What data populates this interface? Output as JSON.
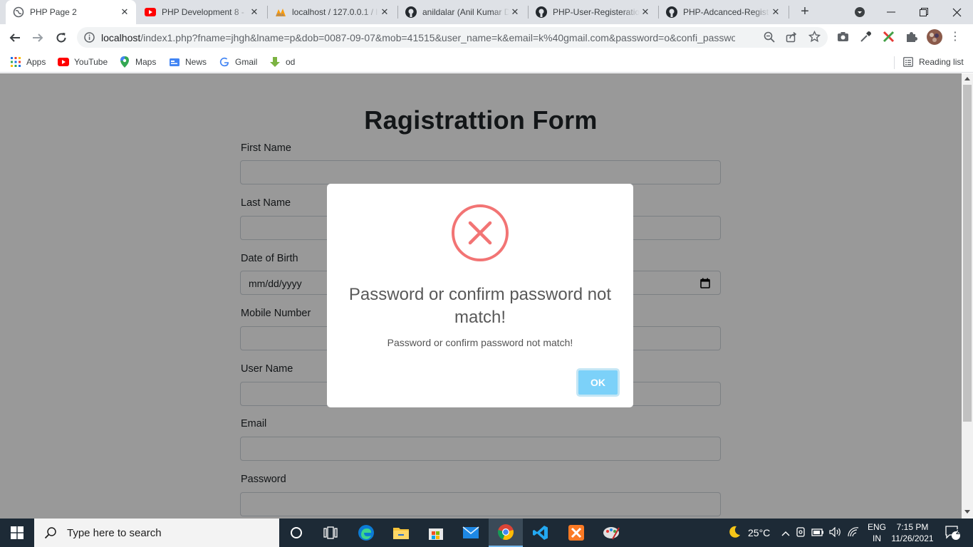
{
  "browser": {
    "tabs": [
      {
        "title": "PHP Page 2",
        "icon": "globe-icon",
        "active": true
      },
      {
        "title": "PHP Development 8 -",
        "icon": "youtube-icon",
        "active": false
      },
      {
        "title": "localhost / 127.0.0.1 / l",
        "icon": "phpmyadmin-icon",
        "active": false
      },
      {
        "title": "anildalar (Anil Kumar D",
        "icon": "github-icon",
        "active": false
      },
      {
        "title": "PHP-User-Registeratio",
        "icon": "github-icon",
        "active": false
      },
      {
        "title": "PHP-Adcanced-Regist",
        "icon": "github-icon",
        "active": false
      }
    ],
    "url_host": "localhost",
    "url_rest": "/index1.php?fname=jhgh&lname=p&dob=0087-09-07&mob=41515&user_name=k&email=k%40gmail.com&password=o&confi_passwo...",
    "bookmarks": [
      {
        "label": "Apps",
        "icon": "apps-grid-icon"
      },
      {
        "label": "YouTube",
        "icon": "youtube-icon"
      },
      {
        "label": "Maps",
        "icon": "maps-pin-icon"
      },
      {
        "label": "News",
        "icon": "news-icon"
      },
      {
        "label": "Gmail",
        "icon": "google-icon"
      },
      {
        "label": "od",
        "icon": "download-arrow-icon"
      }
    ],
    "reading_list": "Reading list"
  },
  "form": {
    "title": "Ragistrattion Form",
    "labels": {
      "first_name": "First Name",
      "last_name": "Last Name",
      "dob": "Date of Birth",
      "mobile": "Mobile Number",
      "username": "User Name",
      "email": "Email",
      "password": "Password"
    },
    "dob_placeholder": "mm/dd/yyyy"
  },
  "modal": {
    "icon": "error-x-icon",
    "title": "Password or confirm password not match!",
    "text": "Password or confirm password not match!",
    "ok_label": "OK"
  },
  "taskbar": {
    "search_placeholder": "Type here to search",
    "weather": "25°C",
    "lang_top": "ENG",
    "lang_bottom": "IN",
    "time": "7:15 PM",
    "date": "11/26/2021",
    "notification_count": "2"
  },
  "colors": {
    "error_red": "#f27474",
    "ok_button": "#7cd1f9",
    "taskbar": "#1d2a36"
  }
}
